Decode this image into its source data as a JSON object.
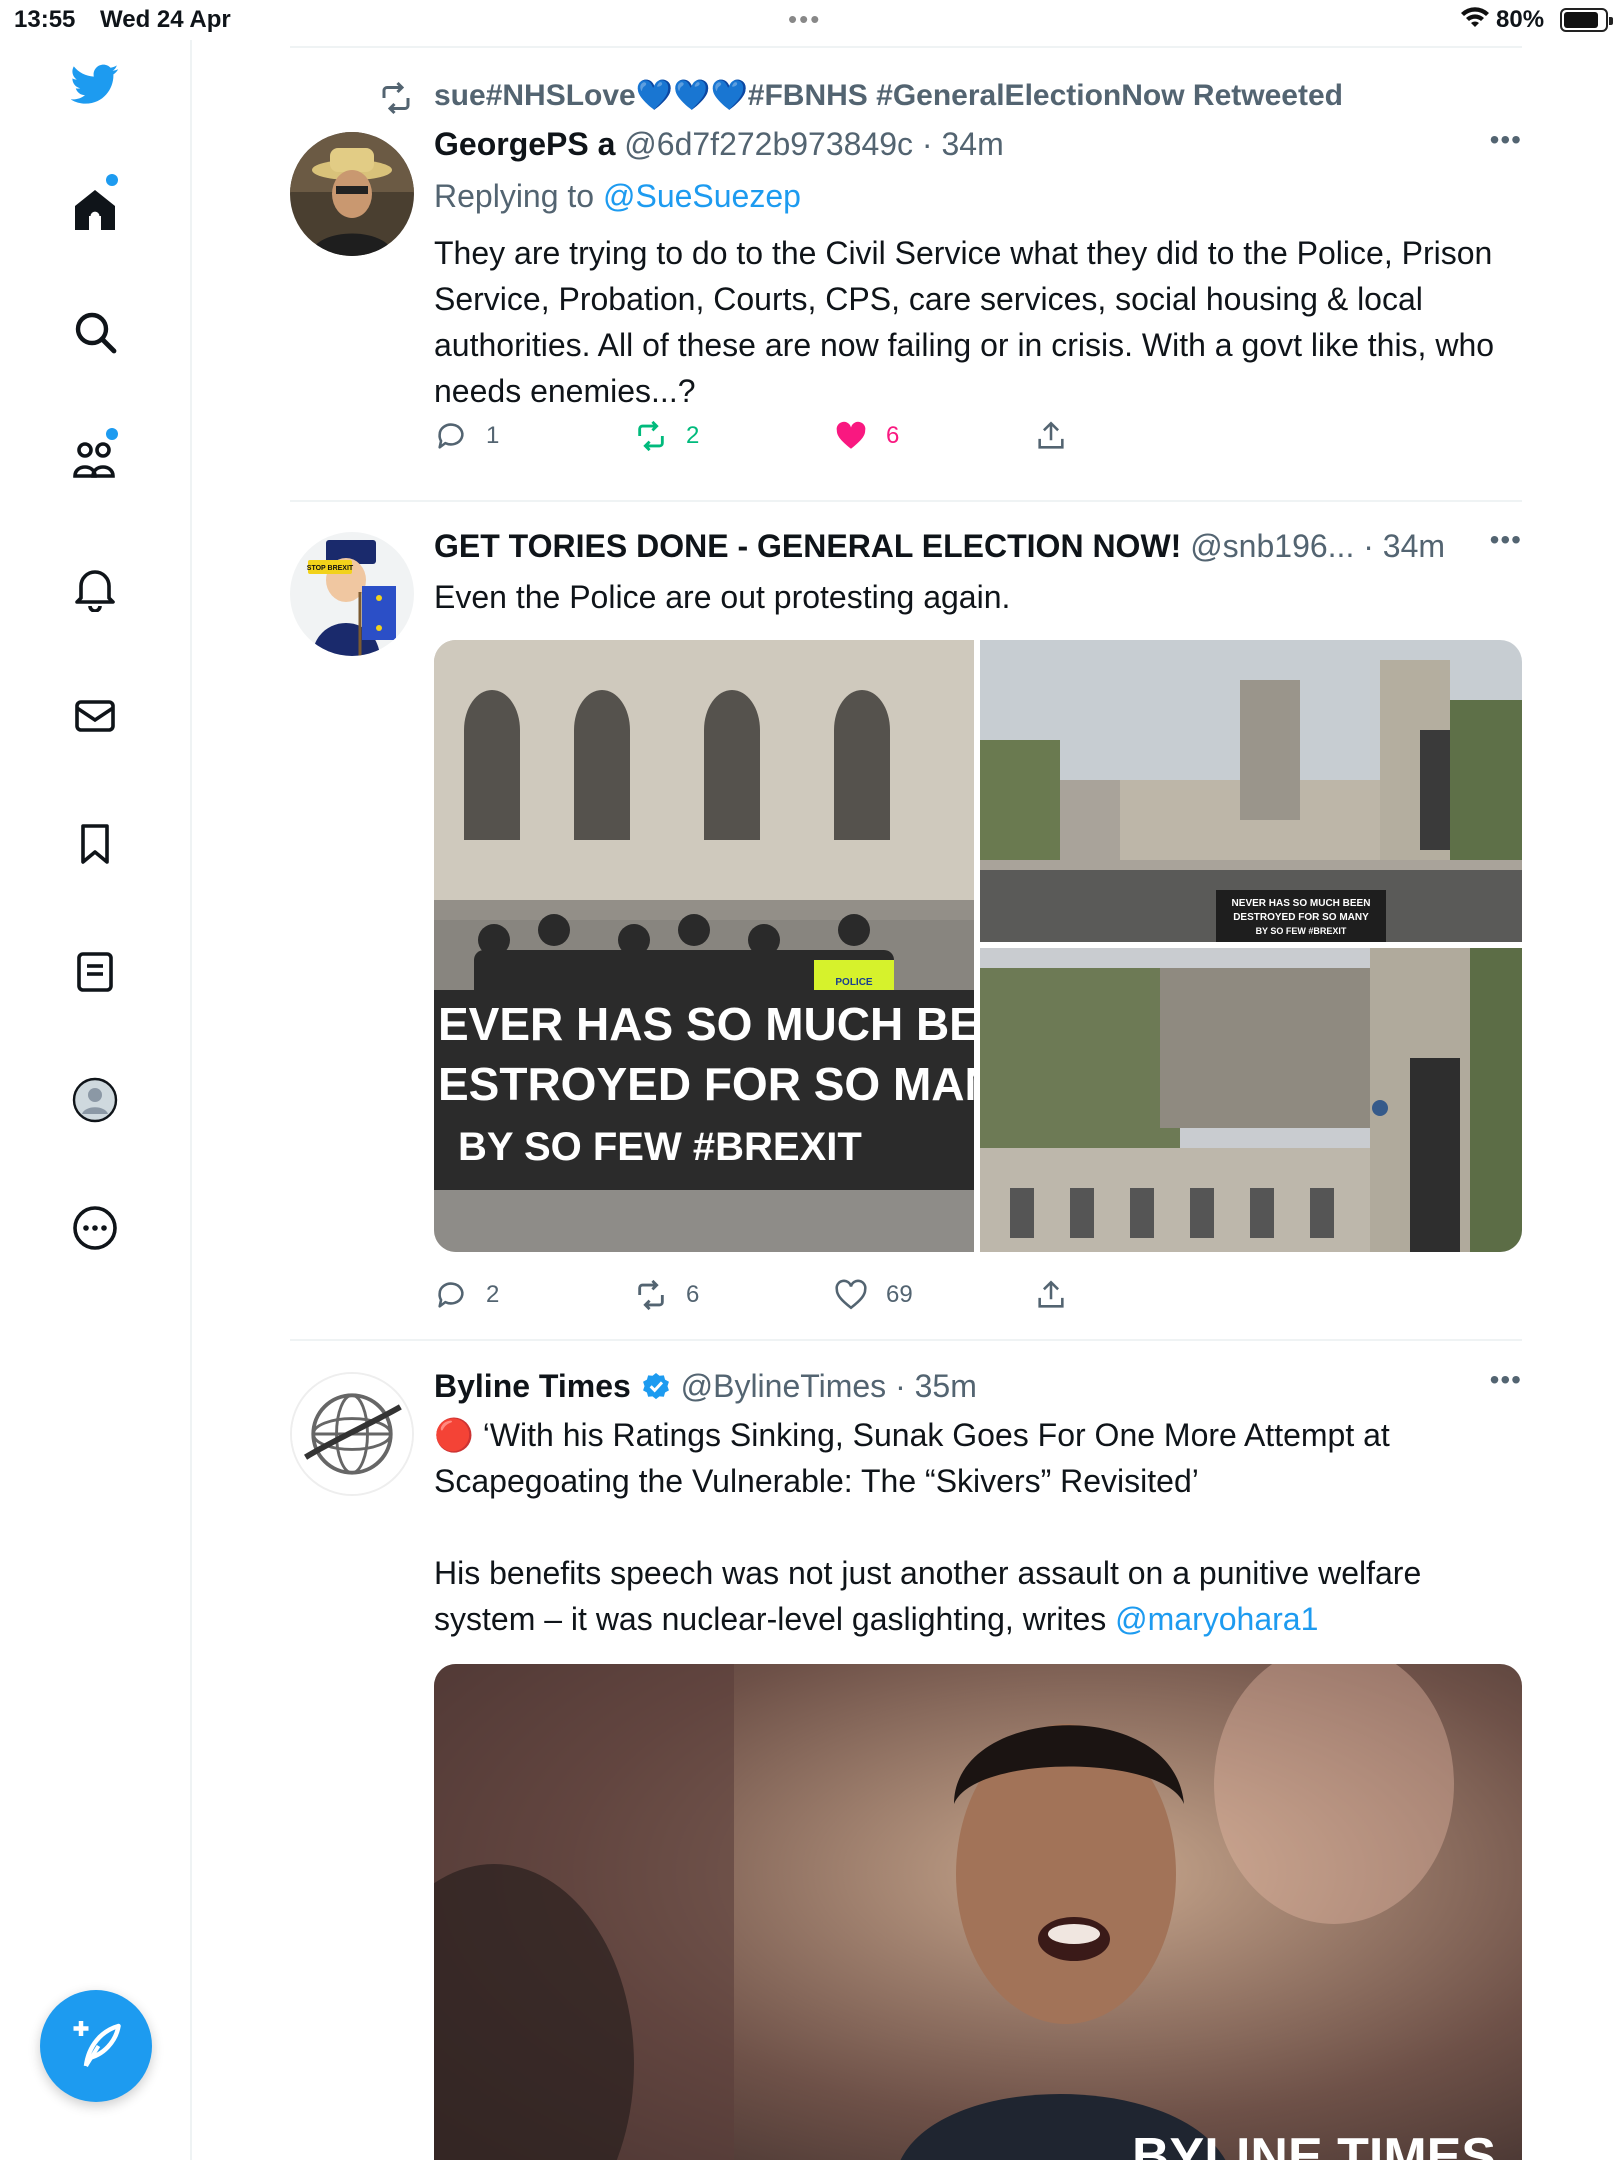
{
  "status_bar": {
    "time": "13:55",
    "date": "Wed 24 Apr",
    "battery": "80%"
  },
  "sidebar": {
    "items": [
      {
        "name": "home",
        "has_dot": true
      },
      {
        "name": "explore"
      },
      {
        "name": "communities",
        "has_dot": true
      },
      {
        "name": "notifications"
      },
      {
        "name": "messages"
      },
      {
        "name": "bookmarks"
      },
      {
        "name": "lists"
      },
      {
        "name": "profile"
      },
      {
        "name": "more"
      }
    ],
    "compose_icon": "compose-icon"
  },
  "tweets": [
    {
      "retweeted_by": "sue#NHSLove💙💙💙#FBNHS #GeneralElectionNow Retweeted",
      "name": "GeorgePS a",
      "handle": "@6d7f272b973849c",
      "time": "34m",
      "replying_prefix": "Replying to",
      "replying_to": "@SueSuezep",
      "text": "They are trying  to do to the Civil Service what they did to the Police, Prison Service, Probation, Courts, CPS, care services, social housing & local authorities. All of these are now failing or in crisis. With a govt like this, who needs enemies...?",
      "replies": "1",
      "retweets": "2",
      "likes": "6"
    },
    {
      "name": "GET TORIES DONE - GENERAL ELECTION NOW!",
      "handle": "@snb196...",
      "time": "34m",
      "text": "Even the Police are out protesting again.",
      "media_banner": [
        "EVER HAS SO MUCH BEI",
        "ESTROYED FOR SO MAN",
        "BY SO FEW  #BREXIT"
      ],
      "media_banner_small": [
        "NEVER HAS SO MUCH BEEN",
        "DESTROYED FOR SO MANY",
        "BY SO FEW  #BREXIT"
      ],
      "avatar_sign": "STOP BREXIT",
      "police_label": "POLICE",
      "replies": "2",
      "retweets": "6",
      "likes": "69"
    },
    {
      "name": "Byline Times",
      "handle": "@BylineTimes",
      "time": "35m",
      "emoji": "🔴",
      "headline": "‘With his Ratings Sinking, Sunak Goes For One More Attempt at Scapegoating the Vulnerable: The “Skivers” Revisited’",
      "body_prefix": "His benefits speech was not just another assault on a punitive welfare system – it was nuclear-level gaslighting, writes ",
      "mention": "@maryohara1",
      "image_watermark": "BYLINE TIMES"
    }
  ],
  "colors": {
    "accent": "#1d9bf0",
    "like": "#f91880",
    "retweet": "#00ba7c",
    "muted": "#536471"
  }
}
